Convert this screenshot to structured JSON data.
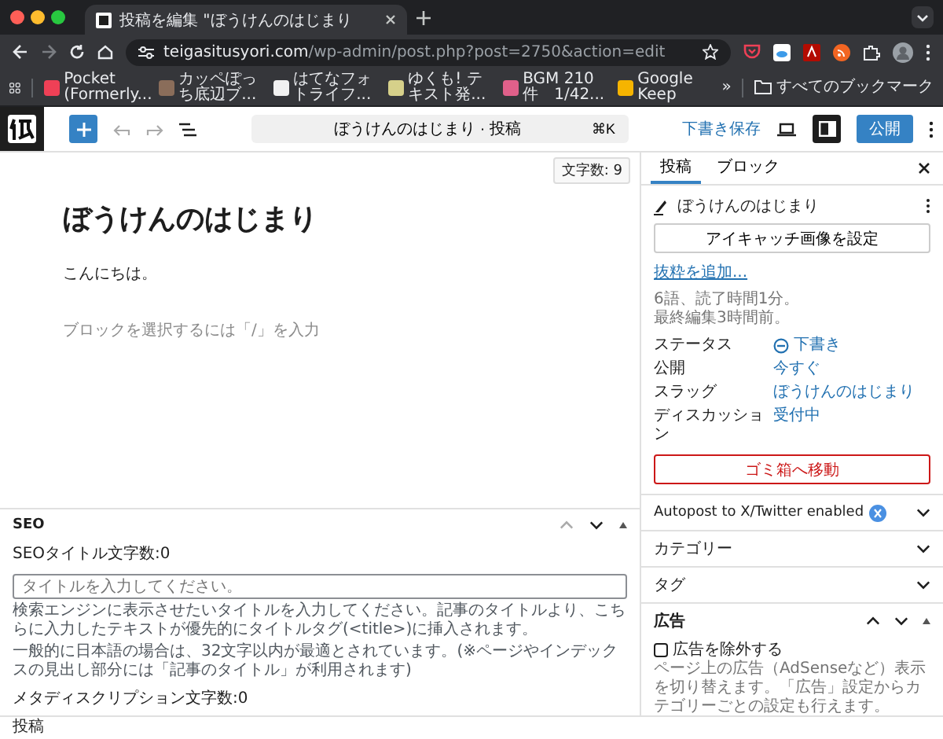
{
  "browser": {
    "tabs": [
      {
        "title": "投稿を編集 \"ぼうけんのはじまり",
        "selected": true
      }
    ],
    "url_host": "teigasitusyori.com",
    "url_path": "/wp-admin/post.php?post=2750&action=edit",
    "bookmarks": [
      {
        "label": "Pocket (Formerly...",
        "color": "#ef4056"
      },
      {
        "label": "カッペぽっち底辺ブ...",
        "color": "#8a6d5a"
      },
      {
        "label": "はてなフォトライフ...",
        "color": "#f1f1f1"
      },
      {
        "label": "ゆくも! テキスト発...",
        "color": "#d6d08a"
      },
      {
        "label": "BGM 210件　1/42...",
        "color": "#e0608a"
      },
      {
        "label": "Google Keep",
        "color": "#f6b400"
      }
    ],
    "more_bookmarks": "»",
    "all_bookmarks": "すべてのブックマーク"
  },
  "header": {
    "command_title": "ぼうけんのはじまり · 投稿",
    "shortcut": "⌘K",
    "save_draft": "下書き保存",
    "publish": "公開"
  },
  "editor": {
    "word_count": "文字数: 9",
    "title": "ぼうけんのはじまり",
    "paragraph": "こんにちは。",
    "placeholder": "ブロックを選択するには「/」を入力"
  },
  "seo": {
    "title": "SEO",
    "title_count_label": "SEOタイトル文字数:0",
    "title_placeholder": "タイトルを入力してください。",
    "help": [
      "検索エンジンに表示させたいタイトルを入力してください。記事のタイトルより、こちらに入力したテキストが優先的にタイトルタグ(<title>)に挿入されます。",
      "一般的に日本語の場合は、32文字以内が最適とされています。(※ページやインデックスの見出し部分には「記事のタイトル」が利用されます)"
    ],
    "meta_label": "メタディスクリプション文字数:0"
  },
  "sidebar": {
    "tabs": [
      {
        "label": "投稿",
        "selected": true
      },
      {
        "label": "ブロック",
        "selected": false
      }
    ],
    "post_title": "ぼうけんのはじまり",
    "featured_button": "アイキャッチ画像を設定",
    "excerpt_link": "抜粋を追加...",
    "meta": [
      "6語、読了時間1分。",
      "最終編集3時間前。"
    ],
    "fields": [
      {
        "label": "ステータス",
        "value": "下書き",
        "kind": "status"
      },
      {
        "label": "公開",
        "value": "今すぐ",
        "kind": "plain"
      },
      {
        "label": "スラッグ",
        "value": "ぼうけんのはじまり",
        "kind": "plain"
      },
      {
        "label": "ディスカッション",
        "value": "受付中",
        "kind": "plain"
      }
    ],
    "trash_button": "ゴミ箱へ移動",
    "panels": [
      {
        "title": "Autopost to X/Twitter enabled",
        "kind": "autopost",
        "expanded": false
      },
      {
        "title": "カテゴリー",
        "kind": "plain",
        "expanded": false
      },
      {
        "title": "タグ",
        "kind": "plain",
        "expanded": false
      }
    ],
    "ad_panel": {
      "title": "広告",
      "exclude_label": "広告を除外する",
      "exclude_checked": false,
      "help": "ページ上の広告（AdSenseなど）表示を切り替えます。「広告」設定からカテゴリーごとの設定も行えます。"
    }
  },
  "status_bar": "投稿"
}
